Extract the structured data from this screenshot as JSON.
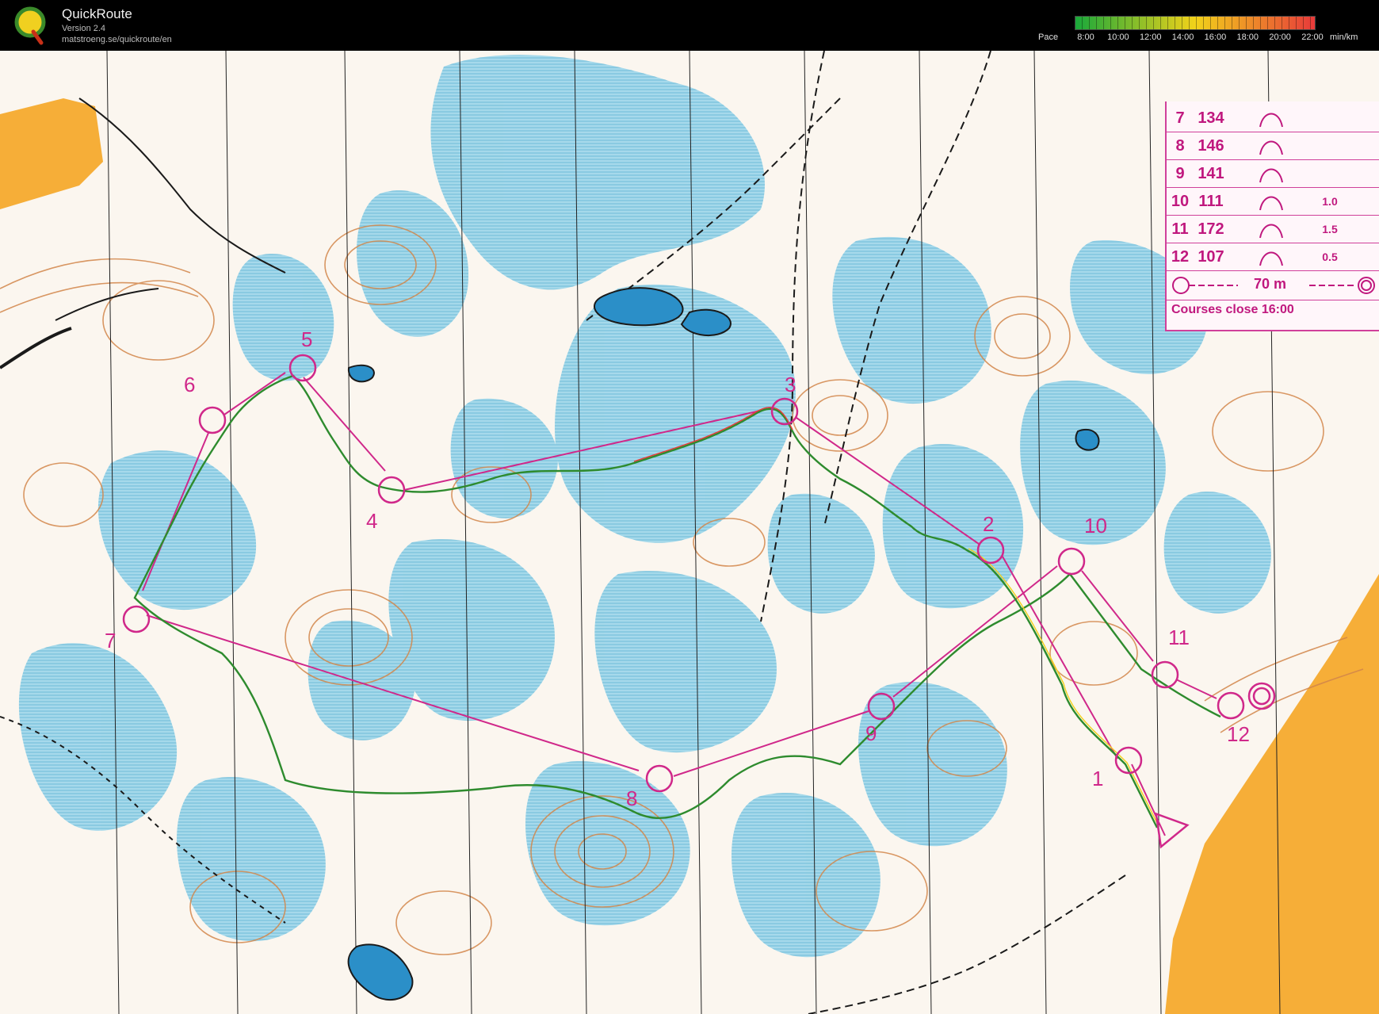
{
  "app": {
    "title": "QuickRoute",
    "version": "Version 2.4",
    "url": "matstroeng.se/quickroute/en"
  },
  "pace": {
    "label": "Pace",
    "ticks": [
      "8:00",
      "10:00",
      "12:00",
      "14:00",
      "16:00",
      "18:00",
      "20:00",
      "22:00"
    ],
    "unit": "min/km",
    "colors": {
      "fast": "#1aa83a",
      "mid": "#f2d21a",
      "slow": "#e83a3a"
    }
  },
  "course_description": {
    "rows": [
      {
        "num": "7",
        "code": "134",
        "note": ""
      },
      {
        "num": "8",
        "code": "146",
        "note": ""
      },
      {
        "num": "9",
        "code": "141",
        "note": ""
      },
      {
        "num": "10",
        "code": "111",
        "note": "1.0"
      },
      {
        "num": "11",
        "code": "172",
        "note": "1.5"
      },
      {
        "num": "12",
        "code": "107",
        "note": "0.5"
      }
    ],
    "finish_line": "70 m",
    "closing": "Courses close 16:00"
  },
  "course": {
    "color": "#d0288a",
    "route_color": "#2e8b2e",
    "control_labels": [
      "1",
      "2",
      "3",
      "4",
      "5",
      "6",
      "7",
      "8",
      "9",
      "10",
      "11",
      "12"
    ]
  },
  "map_colors": {
    "open": "#fbf6ef",
    "marsh": "#8fd0e6",
    "contour": "#d2864a",
    "field": "#f5a623",
    "black": "#1a1a1a"
  }
}
